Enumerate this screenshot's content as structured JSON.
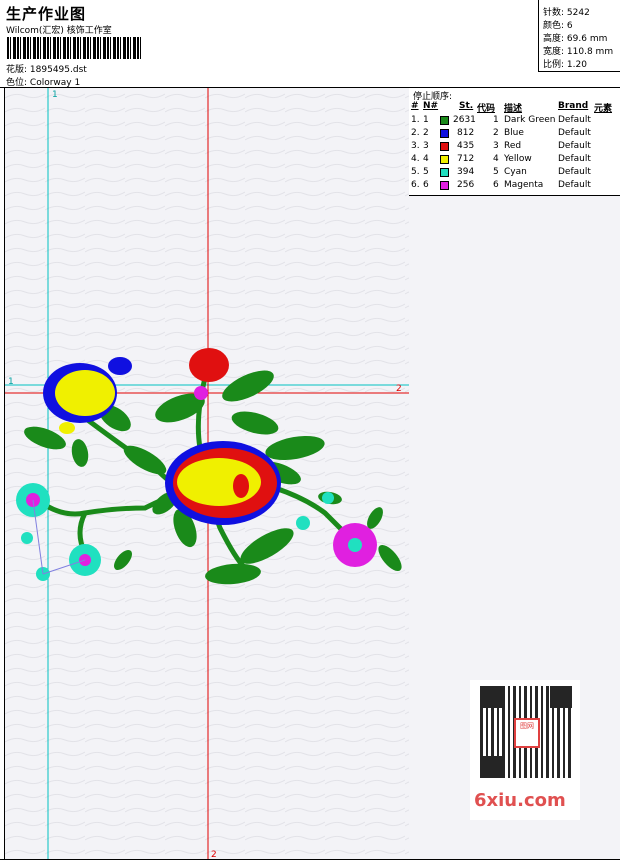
{
  "header": {
    "title": "生产作业图",
    "subtitle": "Wilcom(汇宏) 核饰工作室",
    "design_label": "花版:",
    "design_value": "1895495.dst",
    "colorway_label": "色位:",
    "colorway_value": "Colorway 1"
  },
  "info": {
    "stitches_label": "针数:",
    "stitches_value": "5242",
    "colors_label": "颜色:",
    "colors_value": "6",
    "height_label": "高度:",
    "height_value": "69.6 mm",
    "width_label": "宽度:",
    "width_value": "110.8 mm",
    "scale_label": "比例:",
    "scale_value": "1.20"
  },
  "sequence": {
    "title": "停止顺序:",
    "headers": {
      "hash": "#",
      "n": "N#",
      "st": "St.",
      "code": "代码",
      "desc": "描述",
      "brand": "Brand",
      "elem": "元素"
    },
    "rows": [
      {
        "idx": "1.",
        "n": "1",
        "color": "#1a8a1a",
        "st": "2631",
        "code": "1",
        "desc": "Dark Green",
        "brand": "Default"
      },
      {
        "idx": "2.",
        "n": "2",
        "color": "#1010e0",
        "st": "812",
        "code": "2",
        "desc": "Blue",
        "brand": "Default"
      },
      {
        "idx": "3.",
        "n": "3",
        "color": "#e01010",
        "st": "435",
        "code": "3",
        "desc": "Red",
        "brand": "Default"
      },
      {
        "idx": "4.",
        "n": "4",
        "color": "#f0f000",
        "st": "712",
        "code": "4",
        "desc": "Yellow",
        "brand": "Default"
      },
      {
        "idx": "5.",
        "n": "5",
        "color": "#20e0c0",
        "st": "394",
        "code": "5",
        "desc": "Cyan",
        "brand": "Default"
      },
      {
        "idx": "6.",
        "n": "6",
        "color": "#e020e0",
        "st": "256",
        "code": "6",
        "desc": "Magenta",
        "brand": "Default"
      }
    ]
  },
  "guides": {
    "v1": "1",
    "h1": "1",
    "h2": "2",
    "v2": "2"
  },
  "watermark": {
    "brand": "6xiu.com",
    "stamp": "图网"
  }
}
